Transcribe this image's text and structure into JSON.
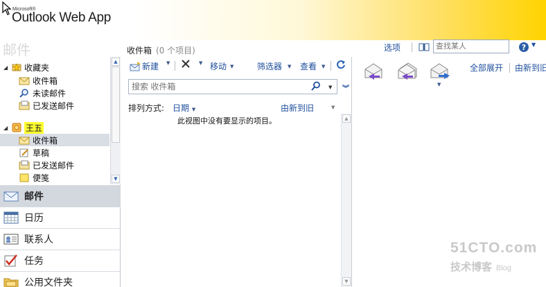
{
  "header": {
    "ms_label": "Microsoft®",
    "app_title": "Outlook Web App"
  },
  "topbar": {
    "section_title": "邮件",
    "folder_name": "收件箱",
    "item_count": "(0 个项目)",
    "options_link": "选项",
    "find_placeholder": "查找某人"
  },
  "tree": {
    "favorites_label": "收藏夹",
    "favorites": [
      "收件箱",
      "未读邮件",
      "已发送邮件"
    ],
    "mailbox_label": "王五",
    "mailbox_items": [
      "收件箱",
      "草稿",
      "已发送邮件",
      "便笺"
    ]
  },
  "nav": {
    "items": [
      "邮件",
      "日历",
      "联系人",
      "任务",
      "公用文件夹"
    ]
  },
  "toolbar": {
    "new_label": "新建",
    "move_label": "移动",
    "filter_label": "筛选器",
    "view_label": "查看"
  },
  "list": {
    "search_placeholder": "搜索 收件箱",
    "sort_label": "排列方式:",
    "sort_field": "日期",
    "sort_order": "由新到旧",
    "empty_message": "此视图中没有要显示的项目。"
  },
  "reading": {
    "expand_all": "全部展开",
    "new_to_old": "由新到旧"
  },
  "watermark": {
    "line1": "51CTO.com",
    "line2": "技术博客",
    "line3": "Blog"
  },
  "colors": {
    "link": "#1e4e9c",
    "header_yellow": "#ffd400",
    "highlight": "#ffff33"
  }
}
